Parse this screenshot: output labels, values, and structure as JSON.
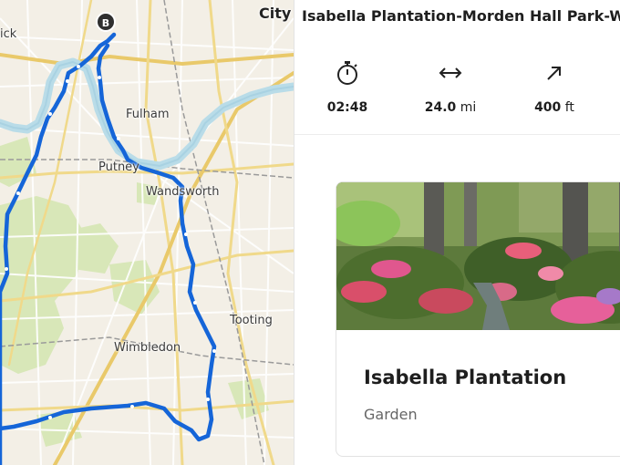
{
  "map": {
    "labels": {
      "city": "City",
      "wick": "ick",
      "fulham": "Fulham",
      "putney": "Putney",
      "wandsworth": "Wandsworth",
      "tooting": "Tooting",
      "wimbledon": "Wimbledon"
    },
    "marker_end": "B",
    "route_color": "#1565d8",
    "river_color": "#b9dce8",
    "park_color": "#d4e5b2"
  },
  "route": {
    "title": "Isabella Plantation-Morden Hall Park-W",
    "stats": [
      {
        "icon": "stopwatch-icon",
        "value": "02:48",
        "unit": ""
      },
      {
        "icon": "distance-arrows-icon",
        "value": "24.0",
        "unit": "mi"
      },
      {
        "icon": "elevation-gain-icon",
        "value": "400",
        "unit": "ft"
      }
    ]
  },
  "poi": {
    "name": "Isabella Plantation",
    "type": "Garden"
  }
}
